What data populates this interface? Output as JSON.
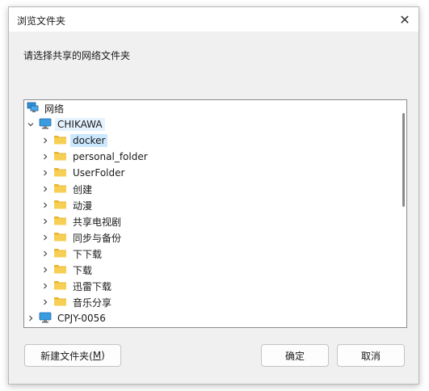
{
  "window": {
    "title": "浏览文件夹",
    "close_glyph": "✕"
  },
  "prompt": "请选择共享的网络文件夹",
  "tree": {
    "root_label": "网络",
    "computer": "CHIKAWA",
    "folders": [
      {
        "label": "docker",
        "selected": true
      },
      {
        "label": "personal_folder",
        "selected": false
      },
      {
        "label": "UserFolder",
        "selected": false
      },
      {
        "label": "创建",
        "selected": false
      },
      {
        "label": "动漫",
        "selected": false
      },
      {
        "label": "共享电视剧",
        "selected": false
      },
      {
        "label": "同步与备份",
        "selected": false
      },
      {
        "label": "下下载",
        "selected": false
      },
      {
        "label": "下载",
        "selected": false
      },
      {
        "label": "迅雷下载",
        "selected": false
      },
      {
        "label": "音乐分享",
        "selected": false
      }
    ],
    "other_computer": "CPJY-0056"
  },
  "buttons": {
    "new_folder_prefix": "新建文件夹(",
    "new_folder_accel": "M",
    "new_folder_suffix": ")",
    "ok": "确定",
    "cancel": "取消"
  },
  "colors": {
    "dialog_bg": "#f0f0f0",
    "selection": "#cce8ff",
    "folder_yellow": "#f5c542"
  },
  "icons": {
    "network": "network-icon",
    "computer": "computer-icon",
    "folder": "folder-icon",
    "expand": "chevron-right-icon",
    "collapse": "chevron-down-icon",
    "close": "close-icon"
  }
}
